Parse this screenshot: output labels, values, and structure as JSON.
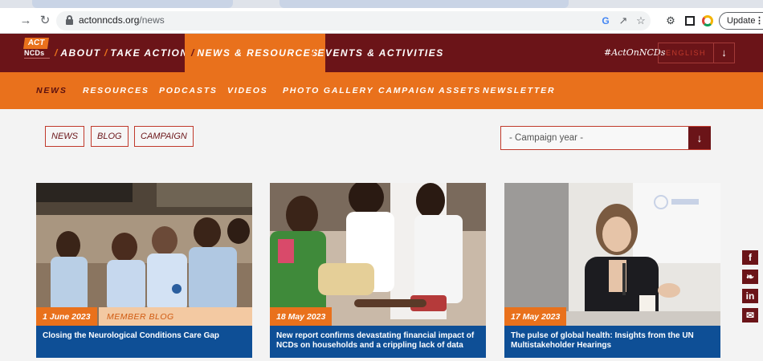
{
  "browser": {
    "url_host": "actonncds.org",
    "url_path": "/news",
    "update_label": "Update",
    "icons": [
      "back-icon",
      "reload-icon",
      "lock-icon",
      "google-icon",
      "share-icon",
      "star-icon",
      "extensions-icon",
      "sidepanel-icon",
      "profile-icon",
      "menu-icon"
    ]
  },
  "header": {
    "logo": {
      "act": "ACT",
      "ncds": "NCDs"
    },
    "nav": [
      {
        "label": "ABOUT"
      },
      {
        "label": "TAKE ACTION"
      },
      {
        "label": "NEWS & RESOURCES",
        "active": true
      },
      {
        "label": "EVENTS & ACTIVITIES"
      }
    ],
    "hashtag": "#ActOnNCDs",
    "language": "ENGLISH",
    "colors": {
      "primary": "#6b1418",
      "accent": "#e9711c",
      "card_title_bg": "#0e4f96"
    }
  },
  "subnav": [
    {
      "label": "NEWS",
      "active": true
    },
    {
      "label": "RESOURCES"
    },
    {
      "label": "PODCASTS"
    },
    {
      "label": "VIDEOS"
    },
    {
      "label": "PHOTO GALLERY"
    },
    {
      "label": "CAMPAIGN ASSETS"
    },
    {
      "label": "NEWSLETTER"
    }
  ],
  "filters": {
    "buttons": [
      "NEWS",
      "BLOG",
      "CAMPAIGN"
    ],
    "campaign_year_select": "- Campaign year -"
  },
  "articles": [
    {
      "date": "1 June 2023",
      "category": "MEMBER BLOG",
      "title": "Closing the Neurological Conditions Care Gap"
    },
    {
      "date": "18 May 2023",
      "category": "",
      "title": "New report confirms devastating financial impact of NCDs on households and a crippling lack of data"
    },
    {
      "date": "17 May 2023",
      "category": "",
      "title": "The pulse of global health: Insights from the UN Multistakeholder Hearings"
    }
  ],
  "social": [
    "facebook-icon",
    "twitter-icon",
    "linkedin-icon",
    "email-icon"
  ]
}
